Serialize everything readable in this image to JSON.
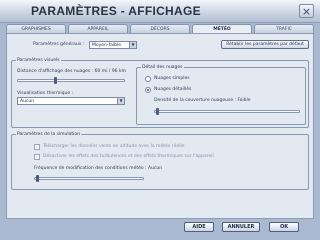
{
  "window": {
    "title": "PARAMÈTRES - AFFICHAGE",
    "close_glyph": "×"
  },
  "tabs": [
    {
      "label": "GRAPHISMES",
      "active": false
    },
    {
      "label": "APPAREIL",
      "active": false
    },
    {
      "label": "DÉCORS",
      "active": false
    },
    {
      "label": "MÉTÉO",
      "active": true
    },
    {
      "label": "TRAFIC",
      "active": false
    }
  ],
  "general": {
    "label": "Paramètres généraux :",
    "value": "Moyen-faible",
    "reset_button": "Rétablir les paramètres par défaut"
  },
  "clouds": {
    "title": "Paramètres visuels",
    "distance_label": "Distance d'affichage des nuages : 60 mi / 96 km",
    "distance_level": 0.35,
    "thermal_label": "Visualisation thermique :",
    "thermal_value": "Aucun",
    "detail": {
      "title": "Détail des nuages",
      "options": [
        {
          "label": "Nuages simples",
          "selected": false
        },
        {
          "label": "Nuages détaillés",
          "selected": true
        }
      ],
      "density_label": "Densité de la couverture nuageuse : Faible",
      "density_level": 0.02
    }
  },
  "simulation": {
    "title": "Paramètres de la simulation",
    "options": [
      {
        "label": "Télécharger les données vents en altitude avec la météo réelle",
        "checked": false
      },
      {
        "label": "Désactiver les effets des turbulences et des effets thermiques sur l'appareil",
        "checked": false
      }
    ],
    "update_label": "Fréquence de modification des conditions météo : Aucun",
    "update_level": 0.02
  },
  "footer": {
    "help": "AIDE",
    "cancel": "ANNULER",
    "ok": "OK"
  }
}
